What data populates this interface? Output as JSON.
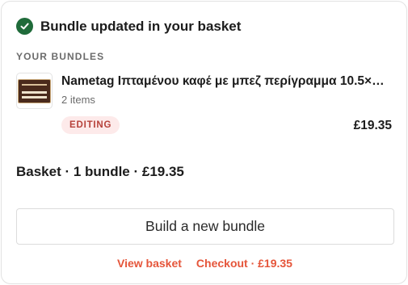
{
  "header": {
    "title": "Bundle updated in your basket",
    "icon": "check-circle-icon",
    "icon_color": "#1f6b3a"
  },
  "bundles_section": {
    "label": "YOUR BUNDLES",
    "items": [
      {
        "title": "Nametag Ιπταμένου καφέ με μπεζ περίγραμμα 10.5×…",
        "count": "2 items",
        "status": "EDITING",
        "price": "£19.35",
        "thumbnail": "nametag-thumbnail"
      }
    ]
  },
  "summary": {
    "text": "Basket · 1 bundle · £19.35"
  },
  "actions": {
    "new_bundle": "Build a new bundle",
    "view_basket": "View basket",
    "checkout": "Checkout · £19.35"
  },
  "colors": {
    "accent": "#e5553a",
    "badge_bg": "#fdeaea",
    "badge_text": "#b6423b",
    "success": "#1f6b3a"
  }
}
